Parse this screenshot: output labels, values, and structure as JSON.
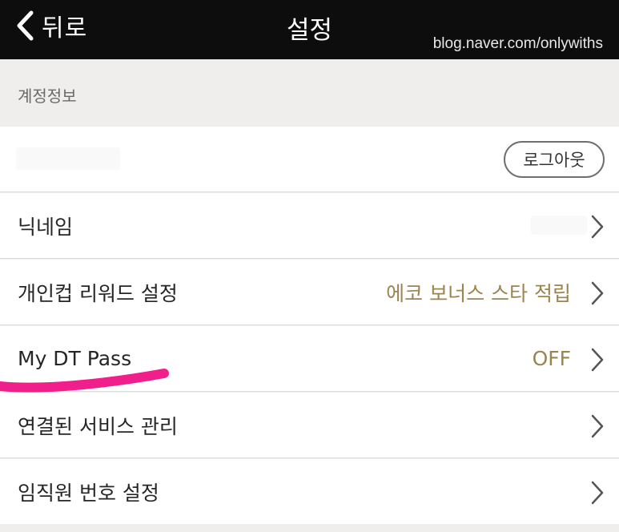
{
  "header": {
    "back_label": "뒤로",
    "title": "설정",
    "watermark": "blog.naver.com/onlywiths"
  },
  "account_section": {
    "label": "계정정보",
    "logout_label": "로그아웃"
  },
  "settings": {
    "items": [
      {
        "label": "닉네임",
        "value": ""
      },
      {
        "label": "개인컵 리워드 설정",
        "value": "에코 보너스 스타 적립"
      },
      {
        "label": "My DT Pass",
        "value": "OFF"
      },
      {
        "label": "연결된 서비스 관리",
        "value": ""
      },
      {
        "label": "임직원 번호 설정",
        "value": ""
      }
    ]
  },
  "colors": {
    "header_bg": "#0d0d0d",
    "value_gold": "#9a8550",
    "annotation_pink": "#f01f8c"
  },
  "icons": [
    "back-chevron-icon",
    "chevron-right-icon"
  ]
}
